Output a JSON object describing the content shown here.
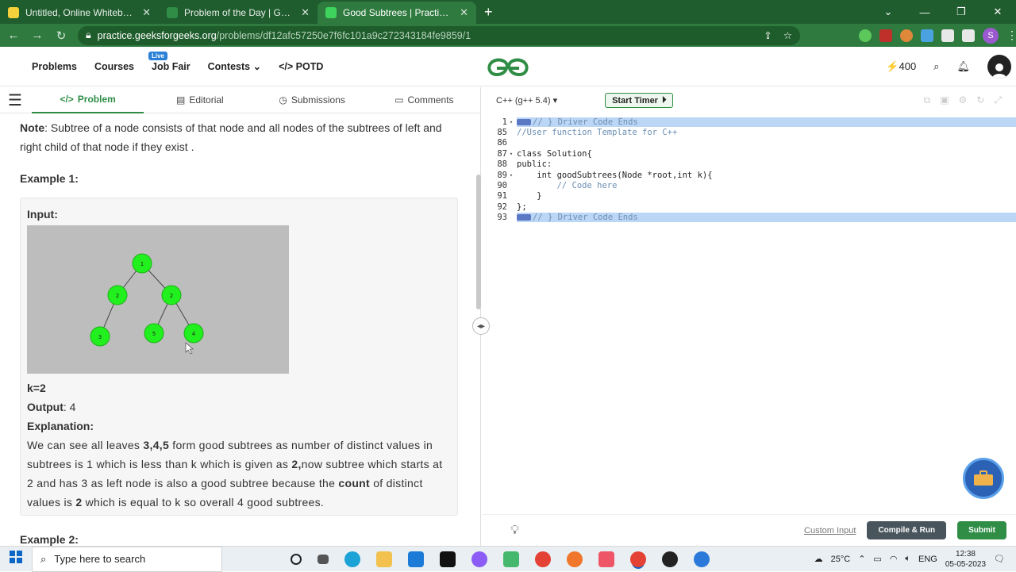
{
  "browser": {
    "tabs": [
      {
        "title": "Untitled, Online Whiteboard for Visual Collaboration",
        "color": "#f5d13b"
      },
      {
        "title": "Problem of the Day | GeeksforGeeks",
        "color": "#2f8d46"
      },
      {
        "title": "Good Subtrees | Practice | GeeksforGeeks",
        "color": "#2f8d46"
      }
    ],
    "url_host": "practice.geeksforgeeks.org",
    "url_path": "/problems/df12afc57250e7f6fc101a9c272343184fe9859/1",
    "profile_initial": "S"
  },
  "header": {
    "menu": [
      "Problems",
      "Courses",
      "Job Fair",
      "Contests",
      "POTD"
    ],
    "live_badge": "Live",
    "logo": "GfG",
    "streak": "400"
  },
  "left_tabs": [
    "Problem",
    "Editorial",
    "Submissions",
    "Comments"
  ],
  "problem": {
    "note_label": "Note",
    "note_text": ": Subtree of a node consists of that node and all nodes of the subtrees of left and right child  of that node  if they exist .",
    "example1_title": "Example 1:",
    "input_label": "Input:",
    "k_line": "k=2",
    "output_label": "Output",
    "output_value": ":  4",
    "explanation_label": "Explanation:",
    "explanation": [
      {
        "t": "We can see all leaves ",
        "b": false
      },
      {
        "t": "3,4,5",
        "b": true
      },
      {
        "t": " form good subtrees as number of distinct values in subtrees is 1 which is less than k which is given as ",
        "b": false
      },
      {
        "t": "2,",
        "b": true
      },
      {
        "t": "now  subtree which starts at 2 and has 3 as left node  is also a good subtree because the ",
        "b": false
      },
      {
        "t": "count",
        "b": true
      },
      {
        "t": " of distinct values is ",
        "b": false
      },
      {
        "t": "2",
        "b": true
      },
      {
        "t": " which is equal to k so overall 4 good subtrees.",
        "b": false
      }
    ],
    "example2_title": "Example 2:",
    "tree_nodes": [
      "1",
      "2",
      "2",
      "3",
      "5",
      "4"
    ]
  },
  "editor": {
    "language": "C++ (g++ 5.4)",
    "timer_label": "Start Timer",
    "lines": [
      {
        "n": "1",
        "code": "// } Driver Code Ends",
        "hl": true,
        "marker": true,
        "fold": true
      },
      {
        "n": "85",
        "code": "//User function Template for C++",
        "hl": false
      },
      {
        "n": "86",
        "code": "",
        "hl": false
      },
      {
        "n": "87",
        "code": "class Solution{",
        "hl": false,
        "fold": true
      },
      {
        "n": "88",
        "code": "public:",
        "hl": false
      },
      {
        "n": "89",
        "code": "    int goodSubtrees(Node *root,int k){",
        "hl": false,
        "fold": true
      },
      {
        "n": "90",
        "code": "        // Code here",
        "hl": false
      },
      {
        "n": "91",
        "code": "    }",
        "hl": false
      },
      {
        "n": "92",
        "code": "};",
        "hl": false
      },
      {
        "n": "93",
        "code": "// } Driver Code Ends",
        "hl": true,
        "marker": true
      }
    ],
    "custom_input": "Custom Input",
    "compile_label": "Compile & Run",
    "submit_label": "Submit"
  },
  "taskbar": {
    "search_placeholder": "Type here to search",
    "weather": "25°C",
    "lang": "ENG",
    "time": "12:38",
    "date": "05-05-2023"
  }
}
